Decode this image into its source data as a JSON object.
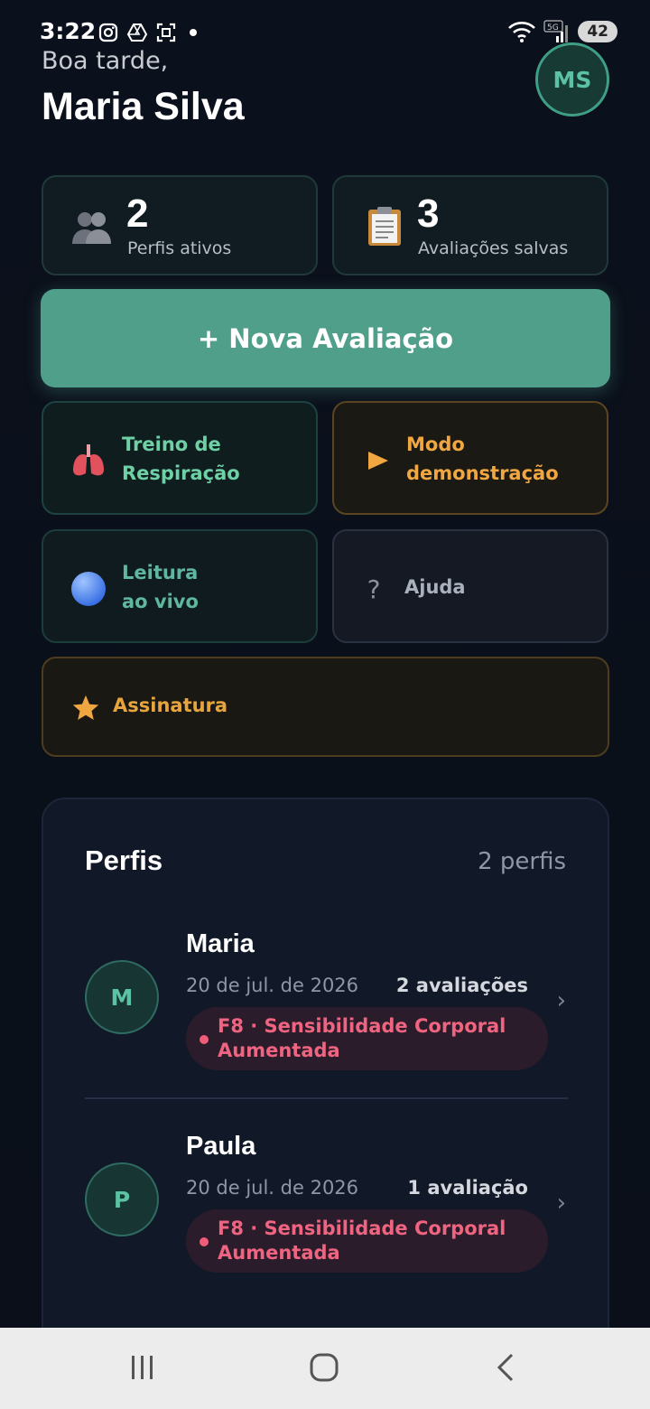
{
  "status_bar": {
    "time": "3:22",
    "battery": "42",
    "network": "5G"
  },
  "header": {
    "greeting": "Boa tarde,",
    "user_name": "Maria Silva",
    "avatar_initials": "MS"
  },
  "stats": [
    {
      "value": "2",
      "label": "Perfis ativos",
      "icon": "people-icon"
    },
    {
      "value": "3",
      "label": "Avaliações salvas",
      "icon": "clipboard-icon"
    }
  ],
  "primary_action": {
    "label": "+ Nova Avaliação"
  },
  "actions": {
    "breathing": {
      "line1": "Treino de",
      "line2": "Respiração",
      "icon": "lungs-icon",
      "color": "#6ed0a5"
    },
    "demo": {
      "line1": "Modo",
      "line2": "demonstração",
      "icon": "play-icon",
      "color": "#f0a742"
    },
    "live": {
      "line1": "Leitura",
      "line2": "ao vivo",
      "icon": "blue-circle-icon",
      "color": "#5eb79e"
    },
    "help": {
      "label": "Ajuda",
      "icon": "question-icon",
      "color": "#a9b1bd"
    },
    "subscription": {
      "label": "Assinatura",
      "icon": "star-icon",
      "color": "#e9a53d"
    }
  },
  "profiles": {
    "title": "Perfis",
    "count": "2 perfis",
    "items": [
      {
        "initial": "M",
        "name": "Maria",
        "date": "20 de jul. de 2026",
        "evaluations": "2 avaliações",
        "badge": "F8 · Sensibilidade Corporal Aumentada"
      },
      {
        "initial": "P",
        "name": "Paula",
        "date": "20 de jul. de 2026",
        "evaluations": "1 avaliação",
        "badge": "F8 · Sensibilidade Corporal Aumentada"
      }
    ]
  },
  "colors": {
    "accent": "#4f9f8b",
    "badge_text": "#ef6480",
    "background": "#0b101b"
  }
}
